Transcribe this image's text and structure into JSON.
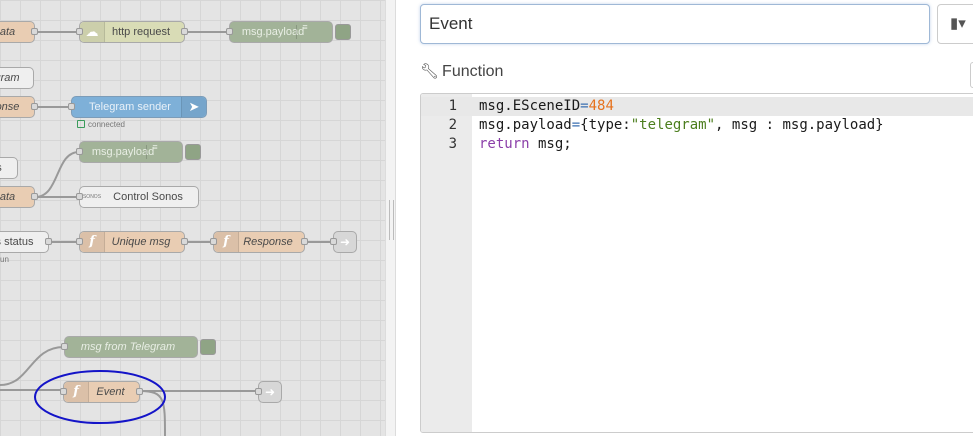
{
  "canvas": {
    "nodes": [
      {
        "id": "n-ata1",
        "label": "ata",
        "italic": true,
        "color": "func"
      },
      {
        "id": "n-http",
        "label": "http request",
        "italic": false,
        "color": "http",
        "icon": "globe-icon"
      },
      {
        "id": "n-dbg1",
        "label": "msg.payload",
        "italic": false,
        "color": "debug"
      },
      {
        "id": "n-gram",
        "label": "gram",
        "italic": true,
        "color": "empty"
      },
      {
        "id": "n-onse",
        "label": "onse",
        "italic": true,
        "color": "func"
      },
      {
        "id": "n-tele",
        "label": "Telegram sender",
        "italic": false,
        "color": "tele",
        "icon": "paper-plane-icon"
      },
      {
        "id": "n-s",
        "label": "s",
        "italic": false,
        "color": "empty"
      },
      {
        "id": "n-dbg2",
        "label": "msg.payload",
        "italic": false,
        "color": "debug"
      },
      {
        "id": "n-ata2",
        "label": "ata",
        "italic": true,
        "color": "func"
      },
      {
        "id": "n-sonos",
        "label": "Control Sonos",
        "italic": false,
        "color": "empty",
        "icon": "sonos-icon"
      },
      {
        "id": "n-status",
        "label": "s status",
        "italic": false,
        "color": "empty"
      },
      {
        "id": "n-unique",
        "label": "Unique msg",
        "italic": true,
        "color": "func",
        "icon": "function-icon"
      },
      {
        "id": "n-resp",
        "label": "Response",
        "italic": true,
        "color": "func",
        "icon": "function-icon"
      },
      {
        "id": "n-dbg3",
        "label": "msg from Telegram",
        "italic": true,
        "color": "debug"
      },
      {
        "id": "n-event",
        "label": "Event",
        "italic": true,
        "color": "func",
        "icon": "function-icon"
      }
    ],
    "tele_status": "connected",
    "status_status": "un",
    "function_icon_glyph": "f",
    "sonos_icon_text": "SONOS"
  },
  "editor": {
    "name_value": "Event",
    "icon_glyph": "▮▾",
    "function_label": "Function",
    "code_lines": [
      {
        "number": "1",
        "tokens": [
          {
            "t": "msg.ESceneID",
            "c": ""
          },
          {
            "t": "=",
            "c": "op"
          },
          {
            "t": "484",
            "c": "num"
          }
        ]
      },
      {
        "number": "2",
        "tokens": [
          {
            "t": "msg.payload",
            "c": ""
          },
          {
            "t": "=",
            "c": "op"
          },
          {
            "t": "{type:",
            "c": ""
          },
          {
            "t": "\"telegram\"",
            "c": "str"
          },
          {
            "t": ", msg : msg.payload}",
            "c": ""
          }
        ]
      },
      {
        "number": "3",
        "tokens": [
          {
            "t": "return",
            "c": "kw"
          },
          {
            "t": " msg;",
            "c": ""
          }
        ]
      }
    ]
  },
  "colors": {
    "func": "#e9cdb3",
    "debug": "#a2b398",
    "http": "#d9dcb6",
    "telegram": "#7eb0d8",
    "highlight_circle": "#1414c8",
    "number_token": "#e6721e",
    "string_token": "#4c7e1e",
    "keyword_token": "#8b3fa9"
  }
}
